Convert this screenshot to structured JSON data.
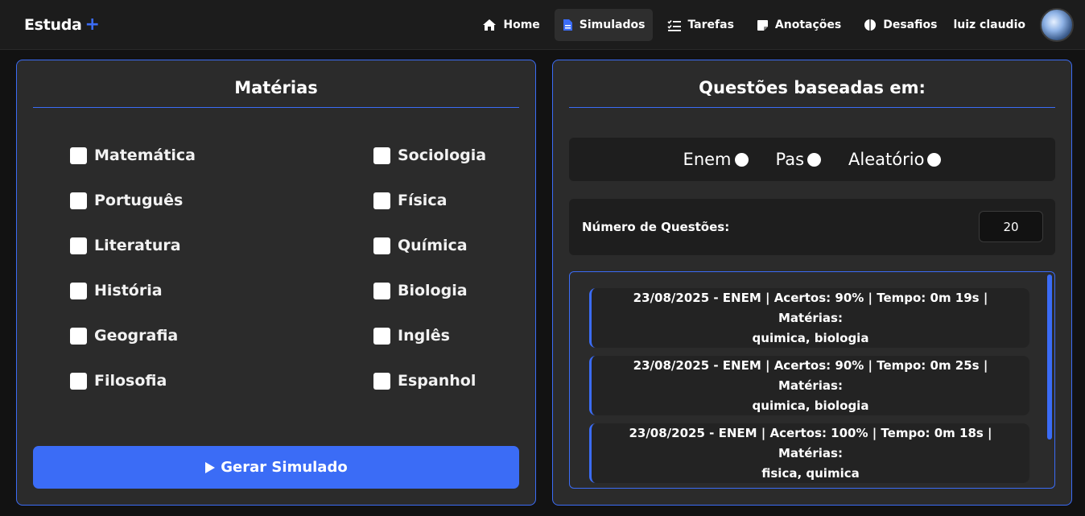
{
  "brand": {
    "name": "Estuda",
    "plus": "+"
  },
  "nav": {
    "items": [
      {
        "label": "Home",
        "icon": "home-icon"
      },
      {
        "label": "Simulados",
        "icon": "document-icon",
        "active": true
      },
      {
        "label": "Tarefas",
        "icon": "checklist-icon"
      },
      {
        "label": "Anotações",
        "icon": "note-icon"
      },
      {
        "label": "Desafios",
        "icon": "brain-icon"
      }
    ],
    "user": "luiz claudio"
  },
  "materias": {
    "title": "Matérias",
    "left": [
      "Matemática",
      "Português",
      "Literatura",
      "História",
      "Geografia",
      "Filosofia"
    ],
    "right": [
      "Sociologia",
      "Física",
      "Química",
      "Biologia",
      "Inglês",
      "Espanhol"
    ],
    "button": "Gerar Simulado"
  },
  "questoes": {
    "title": "Questões baseadas em:",
    "options": [
      "Enem",
      "Pas",
      "Aleatório"
    ],
    "count_label": "Número de Questões:",
    "count_value": "20",
    "history": [
      {
        "line1": "23/08/2025 - ENEM | Acertos: 90% | Tempo: 0m 19s | Matérias:",
        "line2": "quimica, biologia"
      },
      {
        "line1": "23/08/2025 - ENEM | Acertos: 90% | Tempo: 0m 25s | Matérias:",
        "line2": "quimica, biologia"
      },
      {
        "line1": "23/08/2025 - ENEM | Acertos: 100% | Tempo: 0m 18s | Matérias:",
        "line2": "fisica, quimica"
      }
    ]
  },
  "colors": {
    "accent": "#3b6cf6",
    "panel": "#2b2b2b",
    "background": "#121212"
  }
}
